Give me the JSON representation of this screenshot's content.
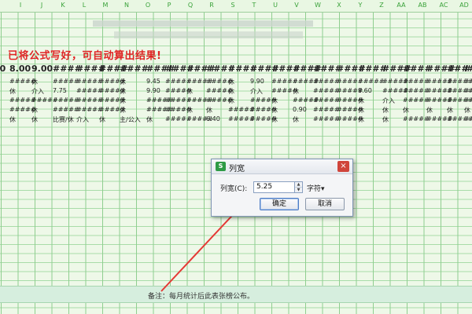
{
  "column_headers": [
    "I",
    "J",
    "K",
    "L",
    "M",
    "N",
    "O",
    "P",
    "Q",
    "R",
    "S",
    "T",
    "U",
    "V",
    "W",
    "X",
    "Y",
    "Z",
    "AA",
    "AB",
    "AC",
    "AD"
  ],
  "notice": "已将公式写好，可自动算出结果!",
  "rows": [
    {
      "kind": "big",
      "cells": [
        "00",
        "8.00",
        "9.00",
        "####",
        "####",
        "####",
        "####",
        "####",
        "####",
        "####",
        "####",
        "####",
        "####",
        "####",
        "####",
        "####",
        "####",
        "####",
        "####",
        "####",
        "####",
        "####",
        "####",
        "####"
      ]
    },
    {
      "kind": "normal",
      "cells": [
        "#",
        "#####",
        "休",
        "#####",
        "#####",
        "#####",
        "休",
        "9.45",
        "#####",
        "#####",
        "#####",
        "休",
        "9.90",
        "#####",
        "#####",
        "#####",
        "#####",
        "#####",
        "#####",
        "#####",
        "#####",
        "#####",
        "#####",
        "#####"
      ]
    },
    {
      "kind": "normal",
      "cells": [
        "#",
        "休",
        "介入",
        "7.75",
        "#####",
        "#####",
        "休",
        "9.90",
        "#####",
        "休",
        "#####",
        "休",
        "介入",
        "#####",
        "休",
        "#####",
        "#####",
        "9.60",
        "#####",
        "#####",
        "#####",
        "#####",
        "#####",
        "#####"
      ]
    },
    {
      "kind": "normal",
      "cells": [
        "5",
        "#####",
        "#####",
        "#####",
        "#####",
        "#####",
        "休",
        "#####",
        "#####",
        "#####",
        "#####",
        "休",
        "#####",
        "休",
        "#####",
        "#####",
        "#####",
        "休",
        "介入",
        "#####",
        "#####",
        "#####",
        "#####",
        "#####"
      ]
    },
    {
      "kind": "normal",
      "cells": [
        "#",
        "#####",
        "休",
        "#####",
        "#####",
        "#####",
        "休",
        "#####",
        "#####",
        "休",
        "休",
        "#####",
        "#####",
        "休",
        "0.90",
        "#####",
        "#####",
        "休",
        "休",
        "休",
        "休",
        "休",
        "休",
        "休"
      ]
    },
    {
      "kind": "normal",
      "cells": [
        "#",
        "休",
        "休",
        "比赛/休",
        "介入",
        "休",
        "主/公入",
        "休",
        "#####",
        "#####",
        "6.40",
        "#####",
        "#####",
        "休",
        "休",
        "#####",
        "#####",
        "休",
        "休",
        "#####",
        "#####",
        "#####",
        "#####",
        "#####"
      ]
    }
  ],
  "footnote": "备注：每月统计后此表张榜公布。",
  "dialog": {
    "app_icon_glyph": "S",
    "title": "列宽",
    "close_glyph": "×",
    "field_label": "列宽(C):",
    "width_value": "5.25",
    "spin_up": "▲",
    "spin_down": "▼",
    "unit": "字符▾",
    "ok_label": "确定",
    "cancel_label": "取消"
  },
  "colors": {
    "notice_text": "#e02424",
    "arrow": "#e53935",
    "grid_line": "#8fce8f"
  }
}
